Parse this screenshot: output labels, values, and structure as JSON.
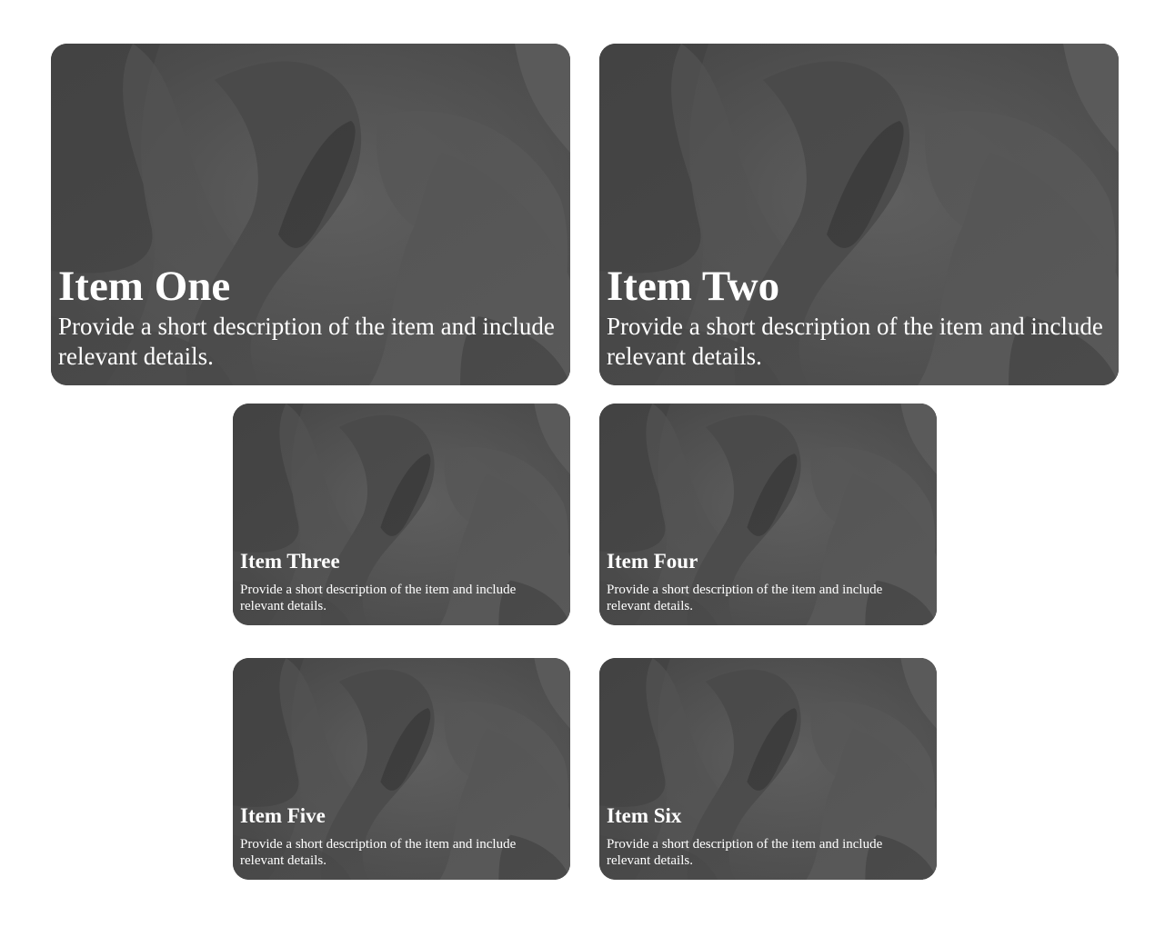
{
  "cards": [
    {
      "title": "Item One",
      "description": "Provide a short description of the item and include relevant details."
    },
    {
      "title": "Item Two",
      "description": "Provide a short description of the item and include relevant details."
    },
    {
      "title": "Item Three",
      "description": "Provide a short description of the item and include relevant details."
    },
    {
      "title": "Item Four",
      "description": "Provide a short description of the item and include relevant details."
    },
    {
      "title": "Item Five",
      "description": "Provide a short description of the item and include relevant details."
    },
    {
      "title": "Item Six",
      "description": "Provide a short description of the item and include relevant details."
    }
  ],
  "colors": {
    "page_background": "#ffffff",
    "card_base": "#505050",
    "text": "#ffffff"
  }
}
